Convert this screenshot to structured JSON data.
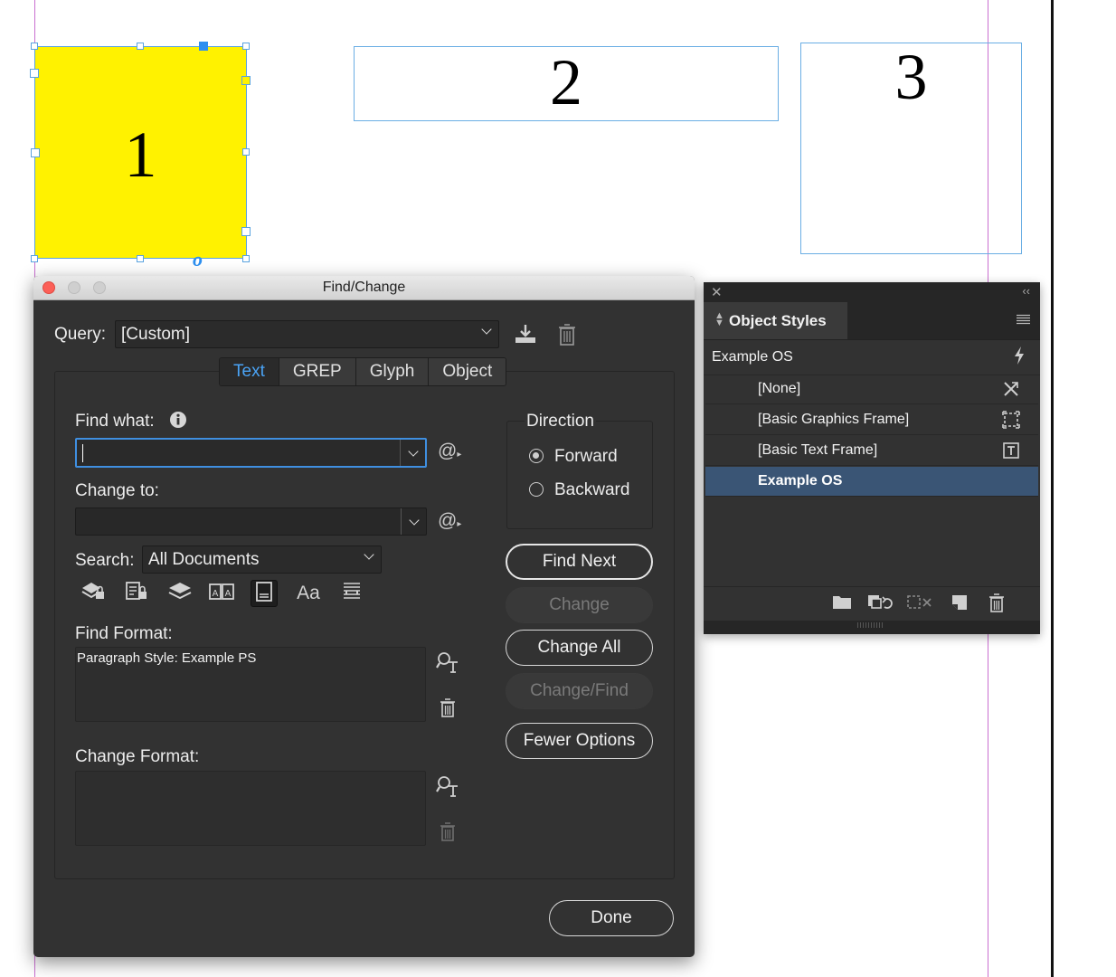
{
  "canvas": {
    "frames": [
      {
        "label": "1"
      },
      {
        "label": "2"
      },
      {
        "label": "3"
      }
    ],
    "frame1_fill": "#fff200",
    "anchor_glyph": "o"
  },
  "dialog": {
    "title": "Find/Change",
    "query_label": "Query:",
    "query_value": "[Custom]",
    "tabs": [
      {
        "label": "Text",
        "active": true
      },
      {
        "label": "GREP",
        "active": false
      },
      {
        "label": "Glyph",
        "active": false
      },
      {
        "label": "Object",
        "active": false
      }
    ],
    "find_what_label": "Find what:",
    "find_what_value": "",
    "change_to_label": "Change to:",
    "change_to_value": "",
    "search_label": "Search:",
    "search_value": "All Documents",
    "find_format_label": "Find Format:",
    "find_format_value": "Paragraph Style: Example PS",
    "change_format_label": "Change Format:",
    "change_format_value": "",
    "direction_label": "Direction",
    "direction_forward": "Forward",
    "direction_backward": "Backward",
    "buttons": {
      "find_next": "Find Next",
      "change": "Change",
      "change_all": "Change All",
      "change_find": "Change/Find",
      "fewer_options": "Fewer Options",
      "done": "Done"
    },
    "special_char_glyph": "@"
  },
  "panel": {
    "title": "Object Styles",
    "current_style": "Example OS",
    "styles": [
      {
        "label": "[None]",
        "selected": false
      },
      {
        "label": "[Basic Graphics Frame]",
        "selected": false
      },
      {
        "label": "[Basic Text Frame]",
        "selected": false
      },
      {
        "label": "Example OS",
        "selected": true
      }
    ]
  },
  "colors": {
    "accent_blue": "#4aa3f5",
    "selection_row": "#3a5575",
    "dialog_bg": "#323232"
  }
}
